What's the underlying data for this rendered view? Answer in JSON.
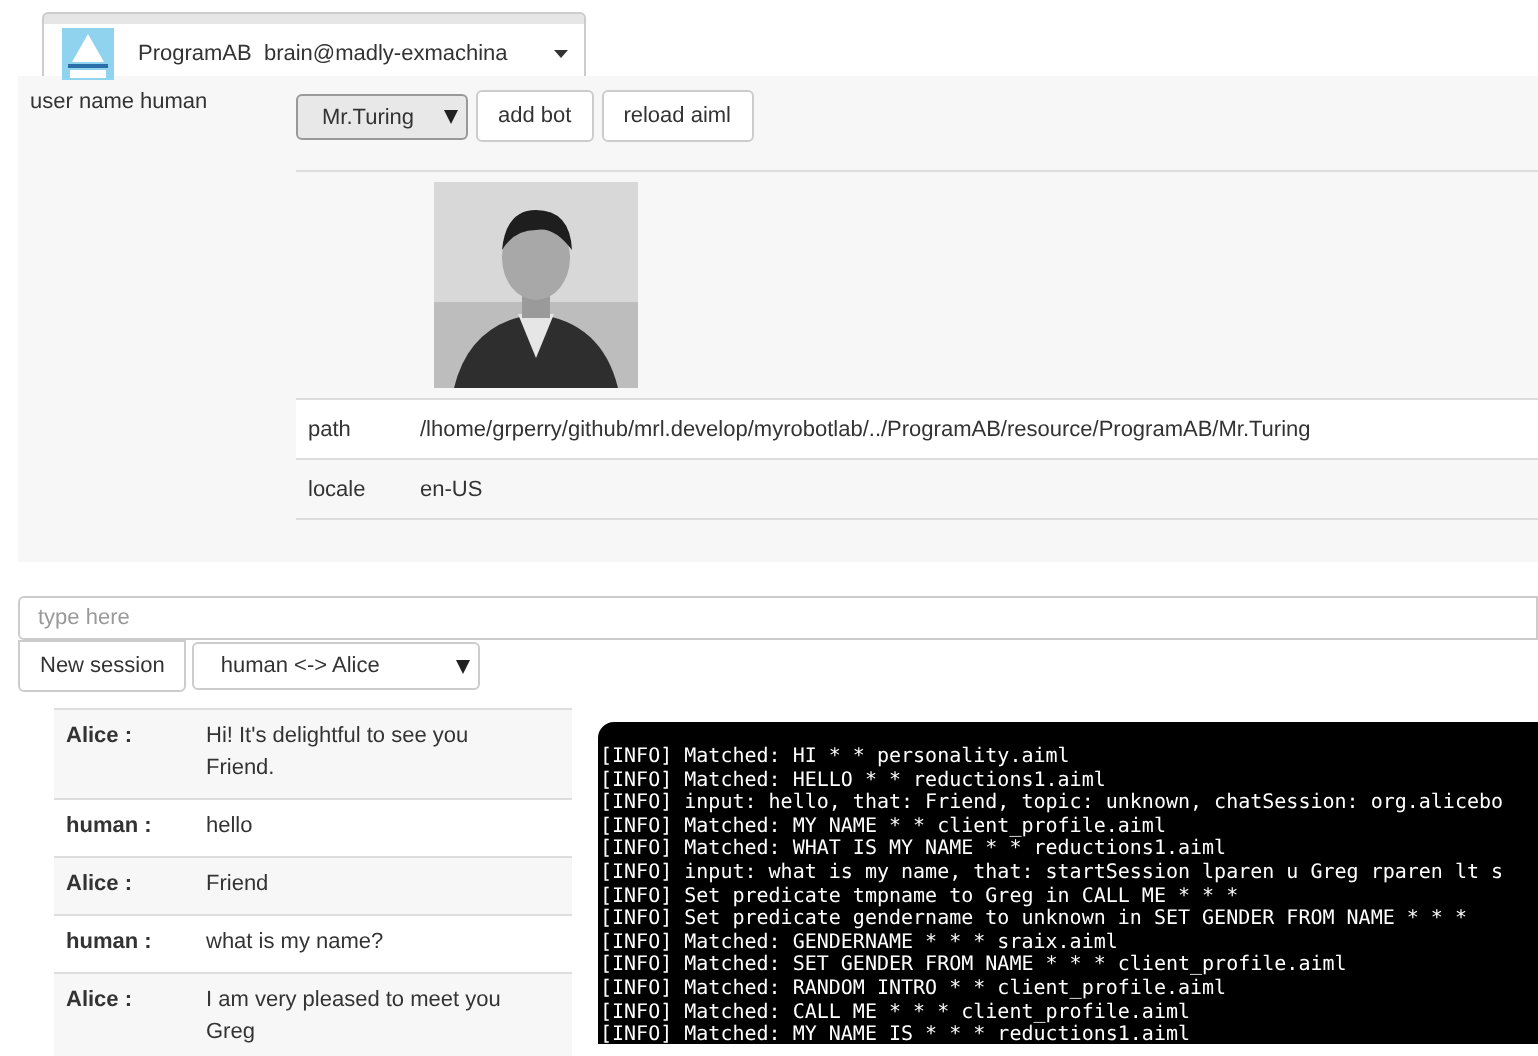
{
  "service_selector": {
    "label": "ProgramAB  brain@madly-exmachina"
  },
  "user_label": "user name human",
  "bot_select": {
    "value": "Mr.Turing"
  },
  "buttons": [
    "add bot",
    "reload aiml"
  ],
  "bot_info": {
    "rows": [
      {
        "label": "path",
        "value": "/lhome/grperry/github/mrl.develop/myrobotlab/../ProgramAB/resource/ProgramAB/Mr.Turing"
      },
      {
        "label": "locale",
        "value": "en-US"
      }
    ]
  },
  "input": {
    "placeholder": "type here"
  },
  "new_session_button": "New session",
  "session_select": {
    "value": "human <-> Alice"
  },
  "chat": [
    {
      "speaker": "Alice :",
      "text": "Hi! It's delightful to see you Friend."
    },
    {
      "speaker": "human :",
      "text": "hello"
    },
    {
      "speaker": "Alice :",
      "text": "Friend"
    },
    {
      "speaker": "human :",
      "text": "what is my name?"
    },
    {
      "speaker": "Alice :",
      "text": "I am very pleased to meet you Greg"
    }
  ],
  "log": [
    "[INFO] Matched: HI * * personality.aiml",
    "[INFO] Matched: HELLO * * reductions1.aiml",
    "[INFO] input: hello, that: Friend, topic: unknown, chatSession: org.alicebo",
    "[INFO] Matched: MY NAME * * client_profile.aiml",
    "[INFO] Matched: WHAT IS MY NAME * * reductions1.aiml",
    "[INFO] input: what is my name, that: startSession lparen u Greg rparen lt s",
    "[INFO] Set predicate tmpname to Greg in CALL ME * * *",
    "[INFO] Set predicate gendername to unknown in SET GENDER FROM NAME * * *",
    "[INFO] Matched: GENDERNAME * * * sraix.aiml",
    "[INFO] Matched: SET GENDER FROM NAME * * * client_profile.aiml",
    "[INFO] Matched: RANDOM INTRO * * client_profile.aiml",
    "[INFO] Matched: CALL ME * * * client_profile.aiml",
    "[INFO] Matched: MY NAME IS * * * reductions1.aiml"
  ]
}
